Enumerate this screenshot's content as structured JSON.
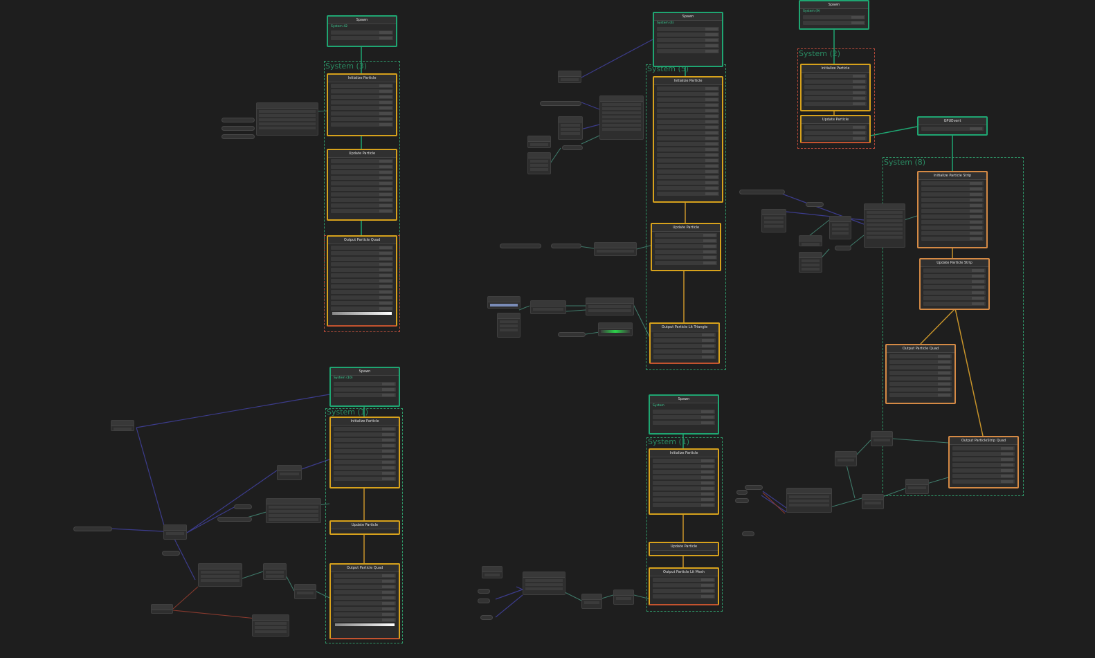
{
  "colors": {
    "background": "#1e1e1e",
    "spawn_context": "#1fa672",
    "init_update_context": "#d7a21c",
    "output_context": "#d58a45",
    "system_frame": "#2f9a6a",
    "wire_float": "#8a8a8a",
    "wire_vector": "#3c3c8c",
    "wire_color": "#a04a3a",
    "wire_flow": "#1fa672"
  },
  "systems": [
    {
      "label": "System (3)"
    },
    {
      "label": "System (1)"
    },
    {
      "label": "System (5)"
    },
    {
      "label": "System (8)"
    },
    {
      "label": "System (2)"
    },
    {
      "label": "System (1)"
    }
  ],
  "contexts": {
    "spawn_a": {
      "title": "Spawn",
      "subtitle": "System 42"
    },
    "init_a": {
      "title": "Initialize Particle"
    },
    "update_a": {
      "title": "Update Particle"
    },
    "output_a": {
      "title": "Output Particle Quad"
    },
    "spawn_b": {
      "title": "Spawn",
      "subtitle": "System (10)"
    },
    "init_b": {
      "title": "Initialize Particle"
    },
    "update_b": {
      "title": "Update Particle"
    },
    "output_b": {
      "title": "Output Particle Quad"
    },
    "spawn_c": {
      "title": "Spawn",
      "subtitle": "System (4)"
    },
    "init_c": {
      "title": "Initialize Particle"
    },
    "update_c": {
      "title": "Update Particle"
    },
    "output_c": {
      "title": "Output Particle Lit Triangle"
    },
    "spawn_d": {
      "title": "Spawn",
      "subtitle": "System"
    },
    "init_d": {
      "title": "Initialize Particle"
    },
    "update_d": {
      "title": "Update Particle"
    },
    "output_d": {
      "title": "Output Particle Lit Mesh"
    },
    "spawn_e": {
      "title": "Spawn",
      "subtitle": "System (9)"
    },
    "init_e": {
      "title": "Initialize Particle"
    },
    "output_e": {
      "title": "Update Particle"
    },
    "gpu_event": {
      "title": "GPUEvent"
    },
    "init_strip": {
      "title": "Initialize Particle Strip"
    },
    "update_strip": {
      "title": "Update Particle Strip"
    },
    "output_quad_f": {
      "title": "Output Particle Quad"
    },
    "output_strip": {
      "title": "Output ParticleStrip Quad"
    }
  }
}
